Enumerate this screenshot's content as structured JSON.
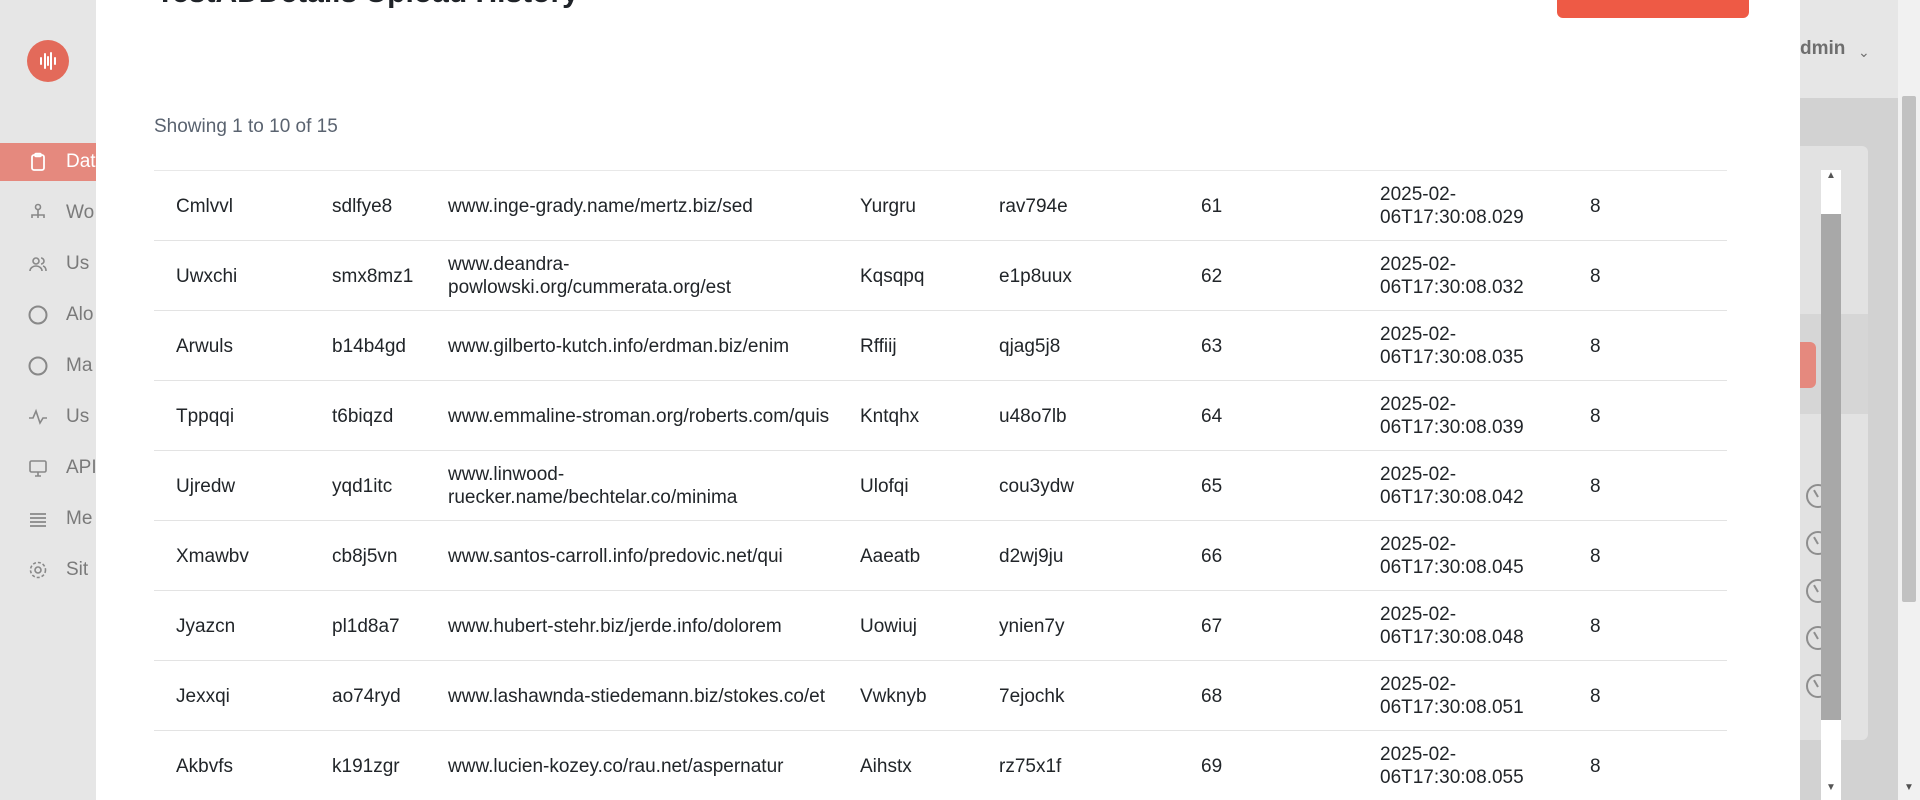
{
  "modal": {
    "title": "TestADDetails Upload History",
    "showing": "Showing 1 to 10 of 15"
  },
  "header": {
    "user_label": "dmin"
  },
  "sidebar": {
    "items": [
      {
        "label": "Dat",
        "icon": "clipboard-icon"
      },
      {
        "label": "Wo",
        "icon": "sitemap-icon"
      },
      {
        "label": "Us",
        "icon": "users-icon"
      },
      {
        "label": "Alo",
        "icon": "circle-icon"
      },
      {
        "label": "Ma",
        "icon": "circle-icon"
      },
      {
        "label": "Us",
        "icon": "activity-icon"
      },
      {
        "label": "API",
        "icon": "monitor-icon"
      },
      {
        "label": "Me",
        "icon": "list-icon"
      },
      {
        "label": "Sit",
        "icon": "gear-icon"
      }
    ]
  },
  "colors": {
    "accent": "#ee5a45",
    "active_nav": "#e5897e"
  },
  "table": {
    "rows": [
      {
        "c0": "Cmlvvl",
        "c1": "sdlfye8",
        "c2": "www.inge-grady.name/mertz.biz/sed",
        "c3": "Yurgru",
        "c4": "rav794e",
        "c5": "61",
        "c6": "2025-02-06T17:30:08.029",
        "c7": "8"
      },
      {
        "c0": "Uwxchi",
        "c1": "smx8mz1",
        "c2": "www.deandra-powlowski.org/cummerata.org/est",
        "c3": "Kqsqpq",
        "c4": "e1p8uux",
        "c5": "62",
        "c6": "2025-02-06T17:30:08.032",
        "c7": "8"
      },
      {
        "c0": "Arwuls",
        "c1": "b14b4gd",
        "c2": "www.gilberto-kutch.info/erdman.biz/enim",
        "c3": "Rffiij",
        "c4": "qjag5j8",
        "c5": "63",
        "c6": "2025-02-06T17:30:08.035",
        "c7": "8"
      },
      {
        "c0": "Tppqqi",
        "c1": "t6biqzd",
        "c2": "www.emmaline-stroman.org/roberts.com/quis",
        "c3": "Kntqhx",
        "c4": "u48o7lb",
        "c5": "64",
        "c6": "2025-02-06T17:30:08.039",
        "c7": "8"
      },
      {
        "c0": "Ujredw",
        "c1": "yqd1itc",
        "c2": "www.linwood-ruecker.name/bechtelar.co/minima",
        "c3": "Ulofqi",
        "c4": "cou3ydw",
        "c5": "65",
        "c6": "2025-02-06T17:30:08.042",
        "c7": "8"
      },
      {
        "c0": "Xmawbv",
        "c1": "cb8j5vn",
        "c2": "www.santos-carroll.info/predovic.net/qui",
        "c3": "Aaeatb",
        "c4": "d2wj9ju",
        "c5": "66",
        "c6": "2025-02-06T17:30:08.045",
        "c7": "8"
      },
      {
        "c0": "Jyazcn",
        "c1": "pl1d8a7",
        "c2": "www.hubert-stehr.biz/jerde.info/dolorem",
        "c3": "Uowiuj",
        "c4": "ynien7y",
        "c5": "67",
        "c6": "2025-02-06T17:30:08.048",
        "c7": "8"
      },
      {
        "c0": "Jexxqi",
        "c1": "ao74ryd",
        "c2": "www.lashawnda-stiedemann.biz/stokes.co/et",
        "c3": "Vwknyb",
        "c4": "7ejochk",
        "c5": "68",
        "c6": "2025-02-06T17:30:08.051",
        "c7": "8"
      },
      {
        "c0": "Akbvfs",
        "c1": "k191zgr",
        "c2": "www.lucien-kozey.co/rau.net/aspernatur",
        "c3": "Aihstx",
        "c4": "rz75x1f",
        "c5": "69",
        "c6": "2025-02-06T17:30:08.055",
        "c7": "8"
      }
    ]
  }
}
